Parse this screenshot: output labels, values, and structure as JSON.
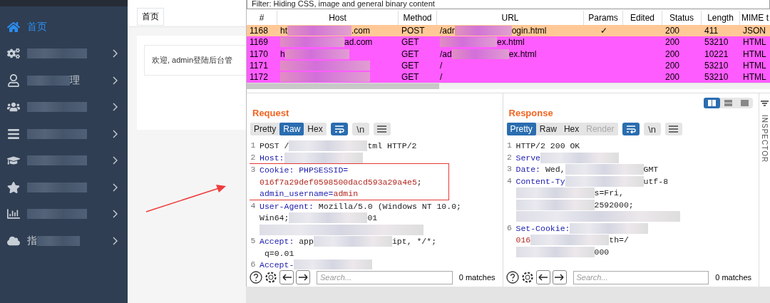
{
  "sidebar": {
    "items": [
      {
        "kind": "home",
        "label": [
          {
            "kind": "text",
            "text": "首页"
          }
        ],
        "selected": true,
        "expandable": false
      },
      {
        "kind": "gears",
        "label": [
          {
            "kind": "blur"
          }
        ],
        "selected": false,
        "expandable": true
      },
      {
        "kind": "user",
        "label": [
          {
            "kind": "blur"
          },
          {
            "kind": "text",
            "text": "理"
          }
        ],
        "selected": false,
        "expandable": true
      },
      {
        "kind": "users",
        "label": [
          {
            "kind": "blur"
          }
        ],
        "selected": false,
        "expandable": true
      },
      {
        "kind": "list",
        "label": [
          {
            "kind": "blur"
          }
        ],
        "selected": false,
        "expandable": true
      },
      {
        "kind": "cap",
        "label": [
          {
            "kind": "blur"
          }
        ],
        "selected": false,
        "expandable": true
      },
      {
        "kind": "star",
        "label": [
          {
            "kind": "blur"
          }
        ],
        "selected": false,
        "expandable": true
      },
      {
        "kind": "chart",
        "label": [
          {
            "kind": "blur"
          }
        ],
        "selected": false,
        "expandable": true
      },
      {
        "kind": "cloud",
        "label": [
          {
            "kind": "text",
            "text": "指"
          },
          {
            "kind": "blur"
          }
        ],
        "selected": false,
        "expandable": true
      }
    ]
  },
  "content": {
    "tab": "首页",
    "welcome": "欢迎, admin登陆后台管"
  },
  "proxy": {
    "filter": "Filter: Hiding CSS, image and general binary content",
    "columns": [
      "#",
      "Host",
      "Method",
      "URL",
      "Params",
      "Edited",
      "Status",
      "Length",
      "MIME t"
    ],
    "rows": [
      {
        "num": "1168",
        "host": [
          {
            "kind": "text",
            "text": "ht"
          },
          {
            "kind": "blur"
          },
          {
            "kind": "text",
            "text": ".com"
          }
        ],
        "method": "POST",
        "url": [
          {
            "kind": "text",
            "text": "/adr"
          },
          {
            "kind": "blur"
          },
          {
            "kind": "text",
            "text": "ogin.html"
          }
        ],
        "params": "✓",
        "status": "200",
        "length": "411",
        "mime": "JSON",
        "color": "#ffc896"
      },
      {
        "num": "1169",
        "host": [
          {
            "kind": "blur"
          },
          {
            "kind": "text",
            "text": "ad.com"
          }
        ],
        "method": "GET",
        "url": [
          {
            "kind": "blur"
          },
          {
            "kind": "text",
            "text": "ex.html"
          }
        ],
        "status": "200",
        "length": "53210",
        "mime": "HTML",
        "color": "#ff5cff"
      },
      {
        "num": "1170",
        "host": [
          {
            "kind": "text",
            "text": "h"
          },
          {
            "kind": "blur"
          }
        ],
        "method": "GET",
        "url": [
          {
            "kind": "text",
            "text": "/ad"
          },
          {
            "kind": "blur"
          },
          {
            "kind": "text",
            "text": "ex.html"
          }
        ],
        "status": "200",
        "length": "10221",
        "mime": "HTML",
        "color": "#ff5cff"
      },
      {
        "num": "1171",
        "host": [
          {
            "kind": "blur"
          }
        ],
        "method": "GET",
        "url": [
          {
            "kind": "text",
            "text": "/"
          }
        ],
        "status": "200",
        "length": "53210",
        "mime": "HTML",
        "color": "#ff5cff"
      },
      {
        "num": "1172",
        "host": [
          {
            "kind": "blur"
          }
        ],
        "method": "GET",
        "url": [
          {
            "kind": "text",
            "text": "/"
          }
        ],
        "status": "200",
        "length": "53210",
        "mime": "HTML",
        "color": "#ff5cff"
      }
    ]
  },
  "request": {
    "title": "Request",
    "view_tabs": [
      {
        "label": "Pretty",
        "selected": false,
        "disabled": false
      },
      {
        "label": "Raw",
        "selected": true,
        "disabled": false
      },
      {
        "label": "Hex",
        "selected": false,
        "disabled": false
      }
    ],
    "tools": [
      {
        "kind": "wrap",
        "selected": true
      },
      {
        "kind": "newline",
        "label": "\\n",
        "selected": false
      },
      {
        "kind": "menu",
        "selected": false
      }
    ],
    "lines": [
      {
        "num": "1",
        "highlighted": false,
        "wrapped": [
          {
            "segments": [
              {
                "kind": "plain",
                "text": "POST /"
              },
              {
                "kind": "blur"
              },
              {
                "kind": "plain",
                "text": "tml HTTP/2"
              }
            ]
          }
        ]
      },
      {
        "num": "2",
        "highlighted": false,
        "wrapped": [
          {
            "segments": [
              {
                "kind": "name",
                "text": "Host:"
              },
              {
                "kind": "blur"
              }
            ]
          }
        ]
      },
      {
        "num": "3",
        "highlighted": true,
        "wrapped": [
          {
            "segments": [
              {
                "kind": "name",
                "text": "Cookie: PHPSESSID="
              }
            ]
          },
          {
            "segments": [
              {
                "kind": "value",
                "text": "016f7a29def0598500dacd593a29a4e5"
              },
              {
                "kind": "plain",
                "text": ";"
              }
            ]
          },
          {
            "segments": [
              {
                "kind": "name",
                "text": "admin_username="
              },
              {
                "kind": "value",
                "text": "admin"
              }
            ]
          }
        ]
      },
      {
        "num": "4",
        "highlighted": false,
        "wrapped": [
          {
            "segments": [
              {
                "kind": "name",
                "text": "User-Agent:"
              },
              {
                "kind": "plain",
                "text": " Mozilla/5.0 (Windows NT 10.0;"
              }
            ]
          },
          {
            "segments": [
              {
                "kind": "plain",
                "text": "Win64;"
              },
              {
                "kind": "blur"
              },
              {
                "kind": "plain",
                "text": "01"
              }
            ]
          },
          {
            "segments": [
              {
                "kind": "blur"
              }
            ]
          }
        ]
      },
      {
        "num": "5",
        "highlighted": false,
        "wrapped": [
          {
            "segments": [
              {
                "kind": "name",
                "text": "Accept:"
              },
              {
                "kind": "plain",
                "text": " app"
              },
              {
                "kind": "blur"
              },
              {
                "kind": "plain",
                "text": "ipt, */*;"
              }
            ]
          },
          {
            "segments": [
              {
                "kind": "plain",
                "text": " q=0.01"
              }
            ]
          }
        ]
      },
      {
        "num": "6",
        "highlighted": false,
        "wrapped": [
          {
            "segments": [
              {
                "kind": "name",
                "text": "Accept-"
              },
              {
                "kind": "blur"
              }
            ]
          }
        ]
      }
    ],
    "search": {
      "placeholder": "Search...",
      "matches": "0 matches"
    }
  },
  "response": {
    "title": "Response",
    "layout_buttons": [
      {
        "kind": "split",
        "selected": true
      },
      {
        "kind": "stack",
        "selected": false
      },
      {
        "kind": "single",
        "selected": false
      }
    ],
    "view_tabs": [
      {
        "label": "Pretty",
        "selected": true,
        "disabled": false
      },
      {
        "label": "Raw",
        "selected": false,
        "disabled": false
      },
      {
        "label": "Hex",
        "selected": false,
        "disabled": false
      },
      {
        "label": "Render",
        "selected": false,
        "disabled": true
      }
    ],
    "tools": [
      {
        "kind": "wrap",
        "selected": true
      },
      {
        "kind": "newline",
        "label": "\\n",
        "selected": false
      },
      {
        "kind": "menu",
        "selected": false
      }
    ],
    "lines": [
      {
        "num": "1",
        "highlighted": false,
        "wrapped": [
          {
            "segments": [
              {
                "kind": "plain",
                "text": "HTTP/2 200 OK"
              }
            ]
          }
        ]
      },
      {
        "num": "2",
        "highlighted": false,
        "wrapped": [
          {
            "segments": [
              {
                "kind": "name",
                "text": "Serve"
              },
              {
                "kind": "blur"
              }
            ]
          }
        ]
      },
      {
        "num": "3",
        "highlighted": false,
        "wrapped": [
          {
            "segments": [
              {
                "kind": "name",
                "text": "Date:"
              },
              {
                "kind": "plain",
                "text": " Wed,"
              },
              {
                "kind": "blur"
              },
              {
                "kind": "plain",
                "text": "GMT"
              }
            ]
          }
        ]
      },
      {
        "num": "4",
        "highlighted": false,
        "wrapped": [
          {
            "segments": [
              {
                "kind": "name",
                "text": "Content-Ty"
              },
              {
                "kind": "blur"
              },
              {
                "kind": "plain",
                "text": "utf-8"
              }
            ]
          },
          {
            "segments": [
              {
                "kind": "blur"
              },
              {
                "kind": "plain",
                "text": "s=Fri,"
              }
            ]
          },
          {
            "segments": [
              {
                "kind": "blur"
              },
              {
                "kind": "plain",
                "text": "2592000;"
              }
            ]
          },
          {
            "segments": [
              {
                "kind": "blur"
              }
            ]
          }
        ]
      },
      {
        "num": "6",
        "highlighted": false,
        "wrapped": [
          {
            "segments": [
              {
                "kind": "name",
                "text": "Set-Cookie:"
              },
              {
                "kind": "blur"
              }
            ]
          },
          {
            "segments": [
              {
                "kind": "value",
                "text": "016"
              },
              {
                "kind": "blur"
              },
              {
                "kind": "plain",
                "text": "th=/"
              }
            ]
          },
          {
            "segments": [
              {
                "kind": "blur"
              },
              {
                "kind": "plain",
                "text": "000"
              }
            ]
          }
        ]
      }
    ],
    "search": {
      "placeholder": "Search...",
      "matches": "0 matches"
    }
  },
  "inspector": {
    "label": "INSPECTOR"
  }
}
